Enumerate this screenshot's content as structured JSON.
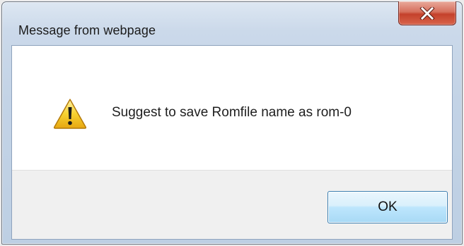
{
  "dialog": {
    "title": "Message from webpage",
    "message": "Suggest to save Romfile name as rom-0",
    "ok_label": "OK",
    "close_glyph": "X",
    "icon": "warning-icon"
  },
  "colors": {
    "close_button": "#c4412b",
    "ok_button_border": "#3c7fb1",
    "warning_fill": "#f7d230"
  }
}
